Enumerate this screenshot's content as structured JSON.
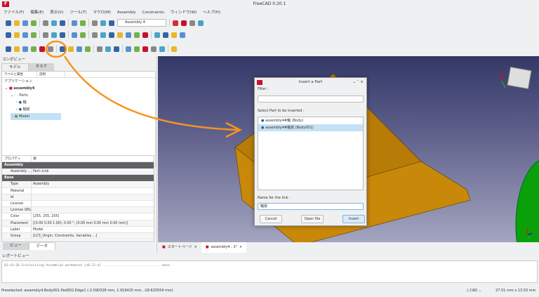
{
  "window": {
    "title": "FreeCAD 0.20.1",
    "logo": "FC"
  },
  "menu": [
    "ファイル(F)",
    "編集(E)",
    "表示(V)",
    "ツール(T)",
    "マクロ(M)",
    "Assembly",
    "Constraints",
    "ウィンドウ(W)",
    "ヘルプ(H)"
  ],
  "toolbar": {
    "workbench_select": "Assembly 4"
  },
  "combo": {
    "title": "コンボビュー",
    "tabs": [
      "モデル",
      "タスク"
    ],
    "tree": {
      "col_label": "ラベルと属性",
      "col_desc": "説明",
      "section": "アプリケーション",
      "items": [
        {
          "label": "assembly4",
          "level": 0
        },
        {
          "label": "Parts",
          "level": 1
        },
        {
          "label": "軸",
          "level": 2
        },
        {
          "label": "軸受",
          "level": 2
        },
        {
          "label": "Model",
          "level": 1,
          "selected": true
        }
      ]
    },
    "props": {
      "col_prop": "プロパティ",
      "col_value": "値",
      "groups": [
        {
          "name": "Assembly",
          "rows": [
            [
              "Assembly ...",
              "Part::Link"
            ]
          ]
        },
        {
          "name": "Base",
          "rows": [
            [
              "Type",
              "Assembly"
            ],
            [
              "Material",
              ""
            ],
            [
              "Id",
              ""
            ],
            [
              "License",
              ""
            ],
            [
              "License URL",
              ""
            ],
            [
              "Color",
              "[255, 255, 255]"
            ],
            [
              "Placement",
              "[(0.00 0.00 1.00); 0.00 °; (0.00 mm  0.00 mm  0.00 mm)]"
            ],
            [
              "Label",
              "Model"
            ],
            [
              "Group",
              "[LCS_Origin, Constraints, Variables ...]"
            ]
          ]
        }
      ]
    },
    "bottom_tabs": [
      "ビュー",
      "データ"
    ]
  },
  "doc_tabs": [
    "スタートページ",
    "assembly4 : 1*"
  ],
  "dialog": {
    "title": "Insert a Part",
    "filter_label": "Filter :",
    "filter_value": "",
    "select_label": "Select Part to be inserted :",
    "parts": [
      {
        "label": "assembly4#軸 (Body)",
        "selected": false
      },
      {
        "label": "assembly4#軸受 (Body001)",
        "selected": true
      }
    ],
    "name_label": "Name for the link :",
    "name_value": "軸受",
    "cancel": "Cancel",
    "open_file": "Open file",
    "insert": "Insert"
  },
  "report": {
    "title": "レポートビュー",
    "log": "01:41:20  Initializing Assembly4 workbench (v0.12.4) .............................. done."
  },
  "status": {
    "text": "Preselected: assembly4.Body001.Pad002.Edge1 (-2.090328 mm, 1.916425 mm, -18.620554 mm)",
    "nav": "CAD",
    "dims": "27.51 mm x 13.53 mm"
  },
  "colors": {
    "accent_annotation": "#f7941d",
    "part": "#c8880a",
    "selection": "#c5e1f5",
    "green_part": "#0aa00a"
  }
}
